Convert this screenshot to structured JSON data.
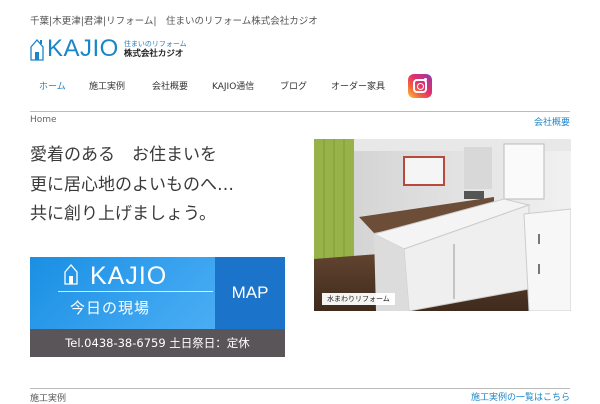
{
  "header": {
    "tagline": "千葉|木更津|君津|リフォーム|　住まいのリフォーム株式会社カジオ",
    "logo_word": "KAJIO",
    "logo_sub1": "住まいのリフォーム",
    "logo_sub2": "株式会社カジオ",
    "accent_color": "#1a86c8"
  },
  "nav": {
    "items": [
      {
        "label": "ホーム",
        "active": true
      },
      {
        "label": "施工実例"
      },
      {
        "label": "会社概要"
      },
      {
        "label": "KAJIO通信"
      },
      {
        "label": "ブログ"
      },
      {
        "label": "オーダー家具"
      }
    ],
    "instagram_icon": "instagram-icon"
  },
  "breadcrumb": {
    "home": "Home",
    "right_link": "会社概要"
  },
  "hero": {
    "lines": [
      "愛着のある　お住まいを",
      "更に居心地のよいものへ…",
      "共に創り上げましょう。"
    ]
  },
  "banner": {
    "word": "KAJIO",
    "subtitle": "今日の現場",
    "map_label": "MAP",
    "phone": "Tel.0438-38-6759 土日祭日：定休"
  },
  "photo": {
    "caption": "水まわりリフォーム"
  },
  "section": {
    "title": "施工実例",
    "link": "施工実例の一覧はこちら"
  }
}
